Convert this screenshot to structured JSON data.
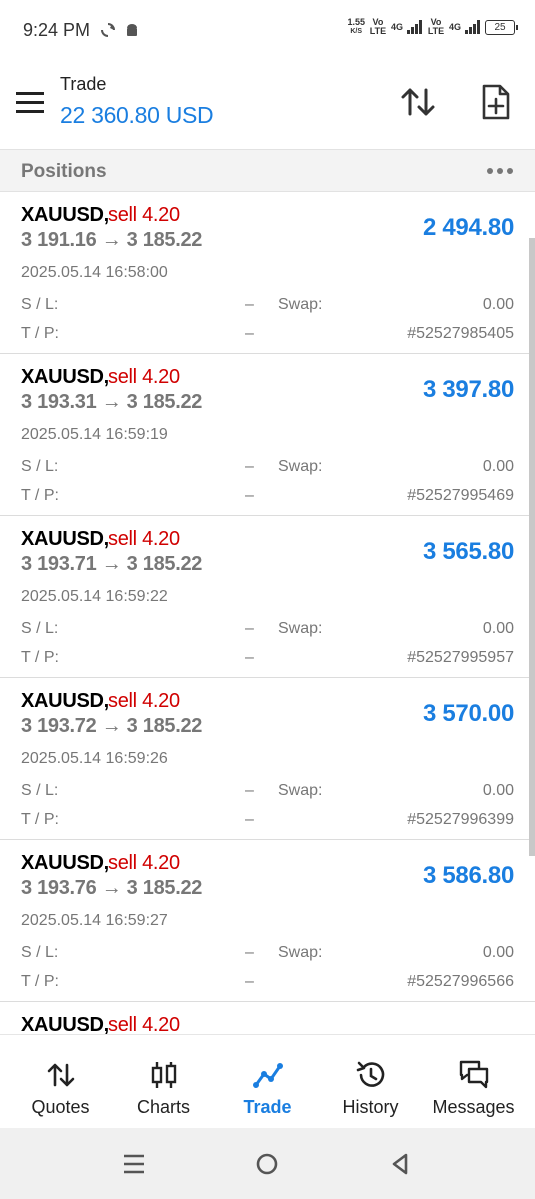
{
  "status_bar": {
    "time": "9:24 PM",
    "net_speed": "1.55",
    "net_unit": "K/S",
    "volte1": "Vo LTE",
    "network1": "4G",
    "volte2": "Vo LTE",
    "network2": "4G",
    "battery": "25"
  },
  "header": {
    "title": "Trade",
    "balance": "22 360.80 USD"
  },
  "section": {
    "title": "Positions"
  },
  "positions": [
    {
      "symbol": "XAUUSD,",
      "side": "sell 4.20",
      "prices": "3 191.16 → 3 185.22",
      "profit": "2 494.80",
      "time": "2025.05.14 16:58:00",
      "sl_label": "S / L:",
      "sl_value": "–",
      "swap_label": "Swap:",
      "swap_value": "0.00",
      "tp_label": "T / P:",
      "tp_value": "–",
      "ticket": "#52527985405"
    },
    {
      "symbol": "XAUUSD,",
      "side": "sell 4.20",
      "prices": "3 193.31 → 3 185.22",
      "profit": "3 397.80",
      "time": "2025.05.14 16:59:19",
      "sl_label": "S / L:",
      "sl_value": "–",
      "swap_label": "Swap:",
      "swap_value": "0.00",
      "tp_label": "T / P:",
      "tp_value": "–",
      "ticket": "#52527995469"
    },
    {
      "symbol": "XAUUSD,",
      "side": "sell 4.20",
      "prices": "3 193.71 → 3 185.22",
      "profit": "3 565.80",
      "time": "2025.05.14 16:59:22",
      "sl_label": "S / L:",
      "sl_value": "–",
      "swap_label": "Swap:",
      "swap_value": "0.00",
      "tp_label": "T / P:",
      "tp_value": "–",
      "ticket": "#52527995957"
    },
    {
      "symbol": "XAUUSD,",
      "side": "sell 4.20",
      "prices": "3 193.72 → 3 185.22",
      "profit": "3 570.00",
      "time": "2025.05.14 16:59:26",
      "sl_label": "S / L:",
      "sl_value": "–",
      "swap_label": "Swap:",
      "swap_value": "0.00",
      "tp_label": "T / P:",
      "tp_value": "–",
      "ticket": "#52527996399"
    },
    {
      "symbol": "XAUUSD,",
      "side": "sell 4.20",
      "prices": "3 193.76 → 3 185.22",
      "profit": "3 586.80",
      "time": "2025.05.14 16:59:27",
      "sl_label": "S / L:",
      "sl_value": "–",
      "swap_label": "Swap:",
      "swap_value": "0.00",
      "tp_label": "T / P:",
      "tp_value": "–",
      "ticket": "#52527996566"
    },
    {
      "symbol": "XAUUSD,",
      "side": "sell 4.20",
      "prices": "",
      "profit": "",
      "time": "",
      "sl_label": "",
      "sl_value": "",
      "swap_label": "",
      "swap_value": "",
      "tp_label": "",
      "tp_value": "",
      "ticket": ""
    }
  ],
  "bottom_nav": {
    "items": [
      {
        "label": "Quotes",
        "icon": "quotes-icon"
      },
      {
        "label": "Charts",
        "icon": "charts-icon"
      },
      {
        "label": "Trade",
        "icon": "trade-icon",
        "active": true
      },
      {
        "label": "History",
        "icon": "history-icon"
      },
      {
        "label": "Messages",
        "icon": "messages-icon"
      }
    ]
  },
  "colors": {
    "accent": "#1a7ee0",
    "sell": "#d00000",
    "muted": "#777777"
  }
}
